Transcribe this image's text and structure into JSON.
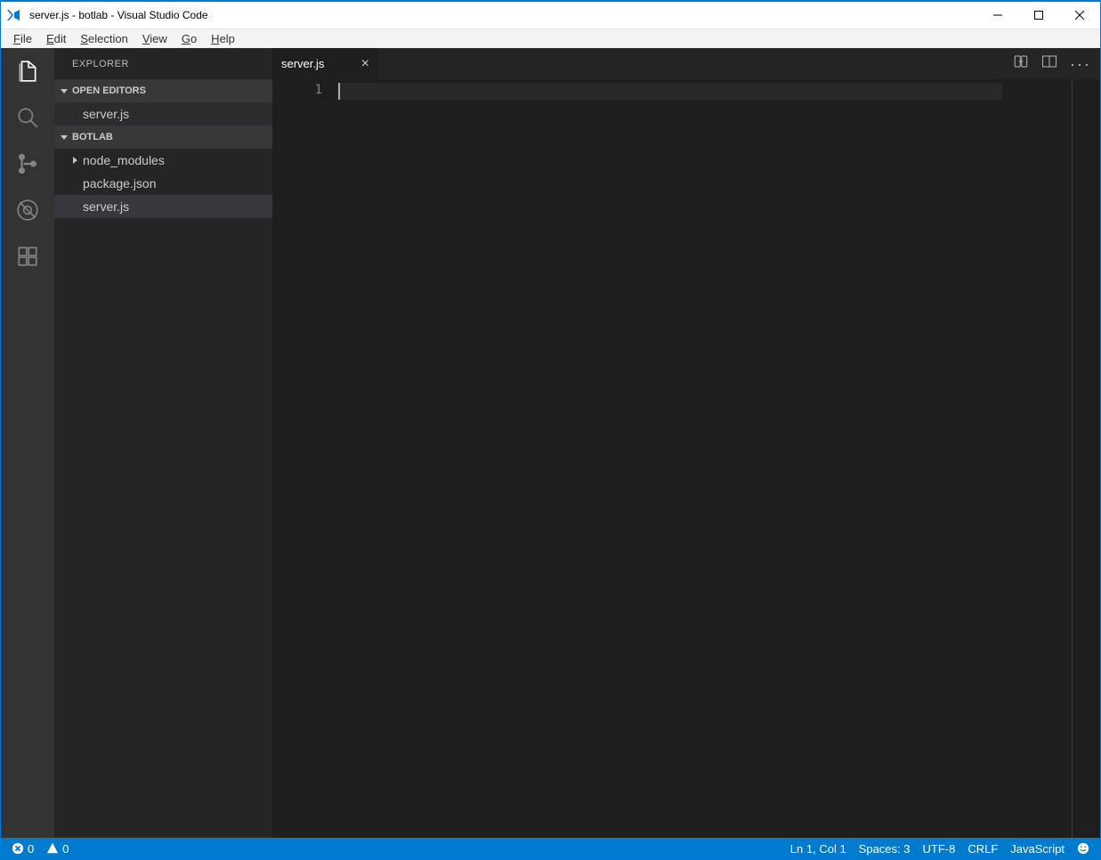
{
  "window": {
    "title": "server.js - botlab - Visual Studio Code"
  },
  "menubar": [
    "File",
    "Edit",
    "Selection",
    "View",
    "Go",
    "Help"
  ],
  "sidebar": {
    "title": "EXPLORER",
    "open_editors_label": "OPEN EDITORS",
    "open_editors": [
      "server.js"
    ],
    "project_label": "BOTLAB",
    "tree": [
      {
        "name": "node_modules",
        "folder": true
      },
      {
        "name": "package.json",
        "folder": false
      },
      {
        "name": "server.js",
        "folder": false,
        "selected": true
      }
    ]
  },
  "tabs": [
    {
      "label": "server.js",
      "active": true,
      "dirty": false
    }
  ],
  "editor": {
    "line_number": "1"
  },
  "status": {
    "errors": "0",
    "warnings": "0",
    "position": "Ln 1, Col 1",
    "spaces": "Spaces: 3",
    "encoding": "UTF-8",
    "eol": "CRLF",
    "language": "JavaScript"
  }
}
